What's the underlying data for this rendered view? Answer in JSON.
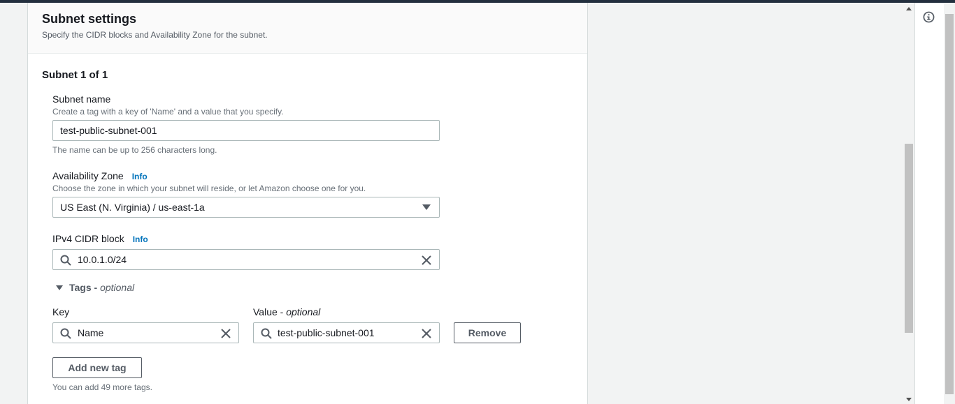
{
  "section": {
    "title": "Subnet settings",
    "description": "Specify the CIDR blocks and Availability Zone for the subnet."
  },
  "subnet": {
    "heading": "Subnet 1 of 1",
    "name": {
      "label": "Subnet name",
      "description": "Create a tag with a key of 'Name' and a value that you specify.",
      "value": "test-public-subnet-001",
      "constraint": "The name can be up to 256 characters long."
    },
    "availability_zone": {
      "label": "Availability Zone",
      "info": "Info",
      "description": "Choose the zone in which your subnet will reside, or let Amazon choose one for you.",
      "value": "US East (N. Virginia) / us-east-1a"
    },
    "cidr": {
      "label": "IPv4 CIDR block",
      "info": "Info",
      "value": "10.0.1.0/24"
    },
    "tags": {
      "toggle_label": "Tags - ",
      "toggle_optional": "optional",
      "key_label": "Key",
      "value_label": "Value - ",
      "value_optional": "optional",
      "rows": [
        {
          "key": "Name",
          "value": "test-public-subnet-001"
        }
      ],
      "remove_label": "Remove",
      "add_label": "Add new tag",
      "remaining": "You can add 49 more tags."
    }
  },
  "icons": {
    "search": "search-icon",
    "clear": "close-icon",
    "dropdown": "caret-down-icon",
    "expand": "caret-down-icon",
    "info": "info-circle-icon"
  },
  "colors": {
    "link": "#0073bb",
    "header_dark": "#232f3e",
    "text": "#16191f",
    "muted": "#687078"
  }
}
